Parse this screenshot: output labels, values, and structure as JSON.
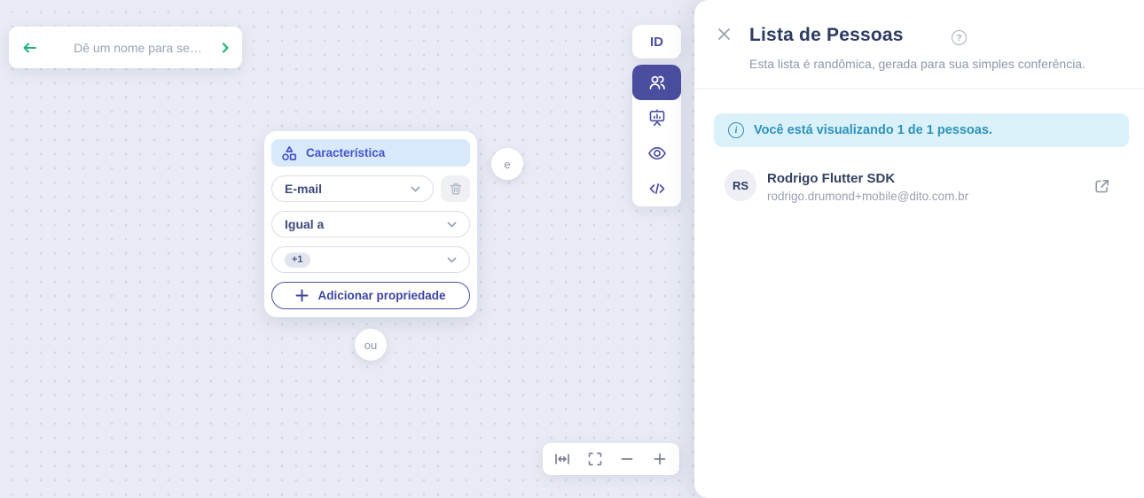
{
  "colors": {
    "accent_indigo": "#4B4E9F",
    "brand_blue": "#4754C9",
    "node_header_bg": "#D8E9FC",
    "green_accent": "#1FB274",
    "navy_text": "#2D3B63",
    "muted_text": "#98A0B2",
    "alert_bg": "#DAF1FA",
    "alert_text": "#2E93BA",
    "canvas_bg": "#E9EBF4"
  },
  "canvas": {
    "name_bar": {
      "placeholder": "Dê um nome para se…"
    },
    "node_card": {
      "header": {
        "label": "Característica"
      },
      "property_select": {
        "value": "E-mail"
      },
      "operator_select": {
        "value": "Igual a"
      },
      "values_select": {
        "badge": "+1"
      },
      "add_property_label": "Adicionar propriedade"
    },
    "connector_and": "e",
    "connector_or": "ou",
    "toolbar": {
      "id_label": "ID"
    }
  },
  "panel": {
    "title": "Lista de Pessoas",
    "subtitle": "Esta lista é randômica, gerada para sua simples conferência.",
    "alert_text": "Você está visualizando 1 de 1 pessoas.",
    "people": [
      {
        "initials": "RS",
        "name": "Rodrigo Flutter SDK",
        "email": "rodrigo.drumond+mobile@dito.com.br"
      }
    ]
  }
}
